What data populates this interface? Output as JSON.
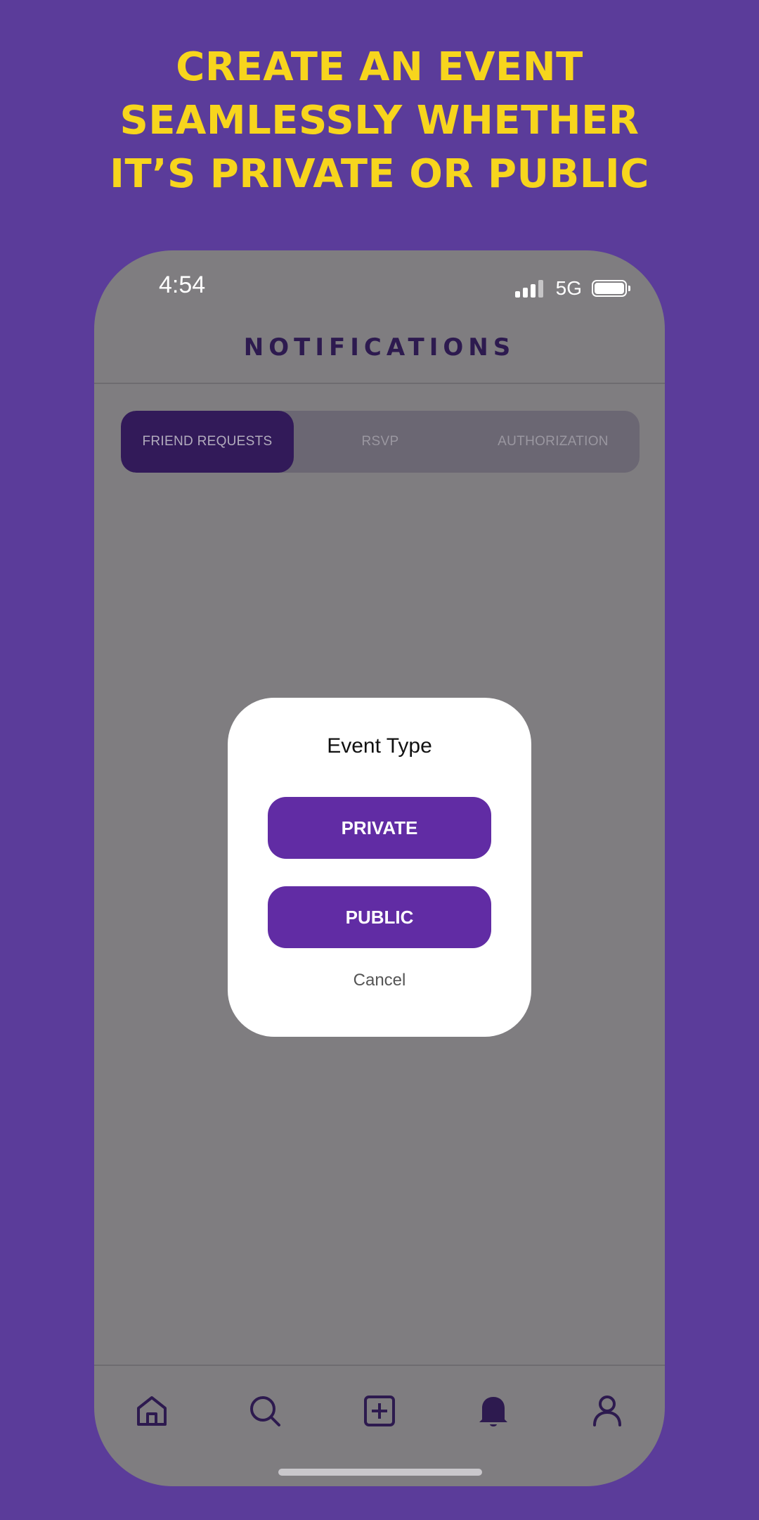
{
  "headline": {
    "line1": "CREATE AN EVENT",
    "line2": "SEAMLESSLY WHETHER",
    "line3": "IT’S PRIVATE OR PUBLIC"
  },
  "status_bar": {
    "time": "4:54",
    "network": "5G"
  },
  "header": {
    "title": "NOTIFICATIONS"
  },
  "tabs": [
    {
      "label": "FRIEND REQUESTS",
      "active": true
    },
    {
      "label": "RSVP",
      "active": false
    },
    {
      "label": "AUTHORIZATION",
      "active": false
    }
  ],
  "modal": {
    "title": "Event Type",
    "private_label": "PRIVATE",
    "public_label": "PUBLIC",
    "cancel_label": "Cancel"
  },
  "bottom_nav": [
    {
      "icon": "home-icon"
    },
    {
      "icon": "search-icon"
    },
    {
      "icon": "add-square-icon"
    },
    {
      "icon": "bell-icon",
      "active": true
    },
    {
      "icon": "profile-icon"
    }
  ],
  "colors": {
    "background": "#5b3c9a",
    "headline": "#f7d51d",
    "accent": "#612ca4",
    "tab_active": "#321a59",
    "nav_icon": "#2d1a4f"
  }
}
